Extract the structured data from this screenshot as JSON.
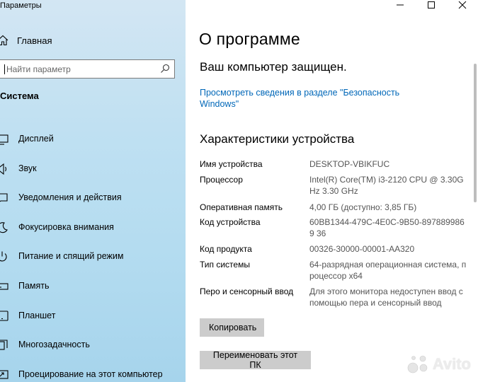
{
  "app": {
    "title": "Параметры"
  },
  "sidebar": {
    "home_label": "Главная",
    "search_placeholder": "Найти параметр",
    "section_label": "Система",
    "items": [
      {
        "label": "Дисплей",
        "icon": "display-icon"
      },
      {
        "label": "Звук",
        "icon": "sound-icon"
      },
      {
        "label": "Уведомления и действия",
        "icon": "notifications-icon"
      },
      {
        "label": "Фокусировка внимания",
        "icon": "focus-assist-icon"
      },
      {
        "label": "Питание и спящий режим",
        "icon": "power-icon"
      },
      {
        "label": "Память",
        "icon": "storage-icon"
      },
      {
        "label": "Планшет",
        "icon": "tablet-icon"
      },
      {
        "label": "Многозадачность",
        "icon": "multitasking-icon"
      },
      {
        "label": "Проецирование на этот компьютер",
        "icon": "projecting-icon"
      }
    ]
  },
  "main": {
    "title": "О программе",
    "protection_status": "Ваш компьютер защищен.",
    "security_link": "Просмотреть сведения в разделе \"Безопасность Windows\"",
    "specs_heading": "Характеристики устройства",
    "specs": [
      {
        "key": "Имя устройства",
        "value": "DESKTOP-VBIKFUC"
      },
      {
        "key": "Процессор",
        "value": "Intel(R) Core(TM) i3-2120 CPU @ 3.30GHz   3.30 GHz"
      },
      {
        "key": "Оперативная память",
        "value": "4,00 ГБ (доступно: 3,85 ГБ)"
      },
      {
        "key": "Код устройства",
        "value": "60BB1344-479C-4E0C-9B50-8978899869 36"
      },
      {
        "key": "Код продукта",
        "value": "00326-30000-00001-AA320"
      },
      {
        "key": "Тип системы",
        "value": "64-разрядная операционная система, процессор x64"
      },
      {
        "key": "Перо и сенсорный ввод",
        "value": "Для этого монитора недоступен ввод с помощью пера и сенсорный ввод"
      }
    ],
    "copy_button": "Копировать",
    "rename_button": "Переименовать этот ПК"
  },
  "watermark": {
    "text": "Avito"
  },
  "colors": {
    "link": "#0067b8",
    "button_bg": "#cccccc",
    "sidebar_bg": "#bfe0f2"
  }
}
